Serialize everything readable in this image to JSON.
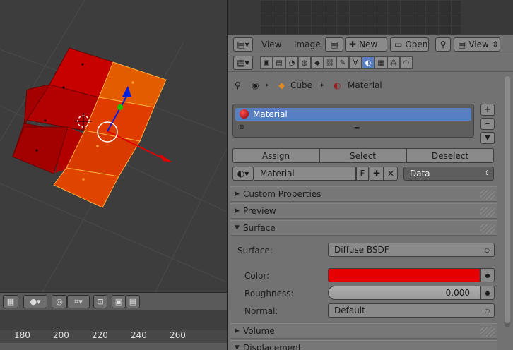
{
  "image_editor": {
    "menu_view": "View",
    "menu_image": "Image",
    "new_label": "New",
    "open_label": "Open",
    "view_dropdown": "View"
  },
  "properties": {
    "breadcrumb": {
      "object": "Cube",
      "material": "Material"
    },
    "material_slots": [
      "Material"
    ],
    "assign_label": "Assign",
    "select_label": "Select",
    "deselect_label": "Deselect",
    "material_name": "Material",
    "fake_user": "F",
    "link_dropdown": "Data",
    "panels": {
      "custom_properties": "Custom Properties",
      "preview": "Preview",
      "surface": "Surface",
      "volume": "Volume",
      "displacement": "Displacement"
    },
    "surface": {
      "surface_label": "Surface:",
      "surface_value": "Diffuse BSDF",
      "color_label": "Color:",
      "color_value": "#e60000",
      "roughness_label": "Roughness:",
      "roughness_value": "0.000",
      "normal_label": "Normal:",
      "normal_value": "Default"
    }
  },
  "timeline": {
    "frames": [
      "180",
      "200",
      "220",
      "240",
      "260"
    ]
  },
  "colors": {
    "accent": "#5680c2",
    "selected_face": "#ff6a00",
    "face_red": "#c80000"
  }
}
